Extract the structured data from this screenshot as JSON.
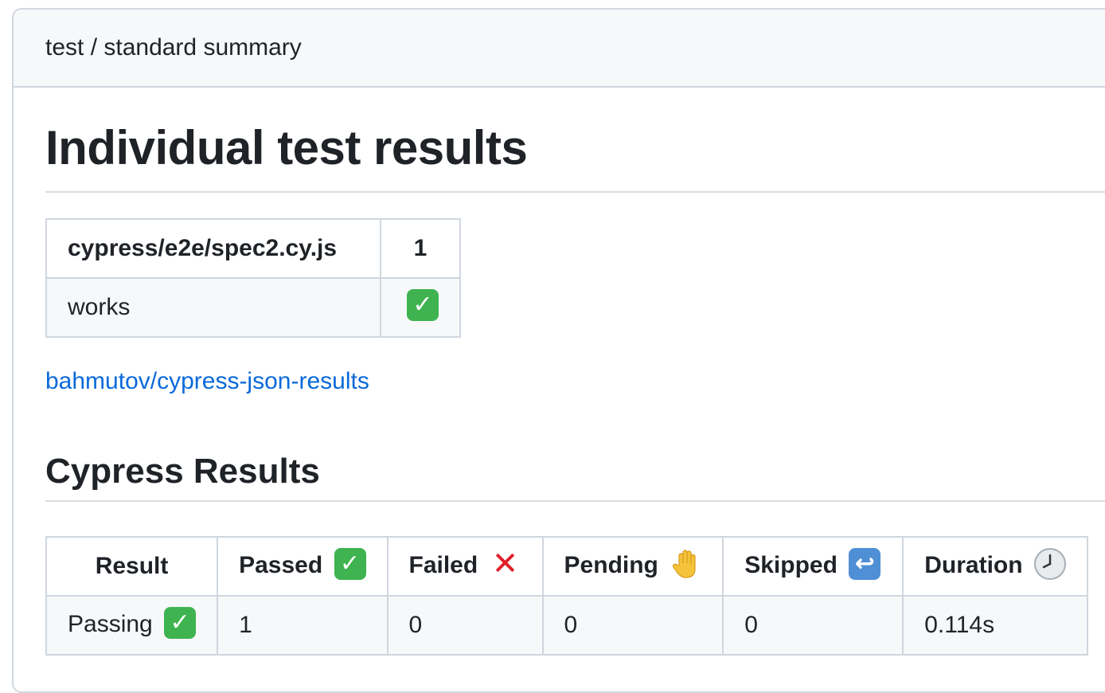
{
  "header": {
    "title": "test / standard summary"
  },
  "main": {
    "heading": "Individual test results",
    "spec_table": {
      "columns": [
        "cypress/e2e/spec2.cy.js",
        "1"
      ],
      "rows": [
        {
          "test": "works",
          "status_icon": "check-mark-icon"
        }
      ]
    },
    "link_text": "bahmutov/cypress-json-results",
    "subheading": "Cypress Results",
    "results_table": {
      "columns": [
        {
          "label": "Result",
          "icon": null
        },
        {
          "label": "Passed",
          "icon": "check-mark-icon"
        },
        {
          "label": "Failed",
          "icon": "cross-mark-icon"
        },
        {
          "label": "Pending",
          "icon": "raised-hand-icon"
        },
        {
          "label": "Skipped",
          "icon": "return-arrow-icon"
        },
        {
          "label": "Duration",
          "icon": "clock-icon"
        }
      ],
      "rows": [
        {
          "result": "Passing",
          "result_icon": "check-mark-icon",
          "passed": "1",
          "failed": "0",
          "pending": "0",
          "skipped": "0",
          "duration": "0.114s"
        }
      ]
    }
  },
  "colors": {
    "link": "#0969da",
    "check_green": "#3fb34f",
    "cross_red": "#e0202a",
    "border": "#d0d7de",
    "header_bg": "#f6f8fa"
  }
}
